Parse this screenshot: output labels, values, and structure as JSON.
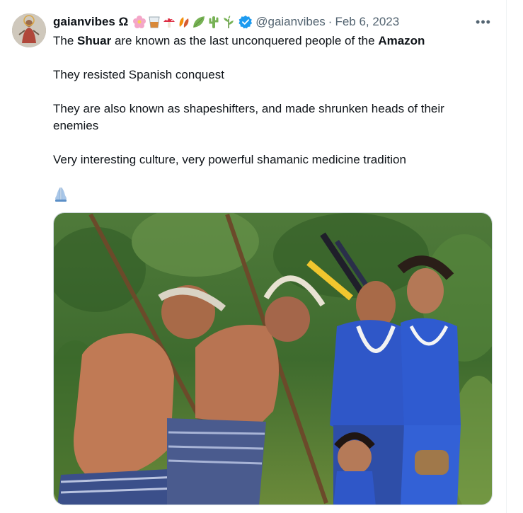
{
  "tweet": {
    "author": {
      "display_name": "gaianvibes Ω",
      "handle": "@gaianvibes",
      "verified": true,
      "name_emojis": [
        "cherry-blossom",
        "tumbler-glass",
        "mushroom",
        "fallen-leaves",
        "leaf",
        "cactus",
        "herb"
      ]
    },
    "separator": "·",
    "date": "Feb 6, 2023",
    "more_label": "•••",
    "text": {
      "line1_pre": "The ",
      "line1_bold1": "Shuar",
      "line1_mid": " are known as the last unconquered people of the ",
      "line1_bold2": "Amazon",
      "line2": "They resisted Spanish conquest",
      "line3": "They are also known as shapeshifters, and made shrunken heads of their enemies",
      "line4": "Very interesting culture, very powerful shamanic medicine tradition",
      "emoji": "folded-hands"
    },
    "media": {
      "kind": "photo",
      "subject": "shuar-people-photo"
    }
  },
  "colors": {
    "text_primary": "#0f1419",
    "text_secondary": "#536471",
    "verified_blue": "#1d9bf0",
    "border": "#cfd9de"
  }
}
